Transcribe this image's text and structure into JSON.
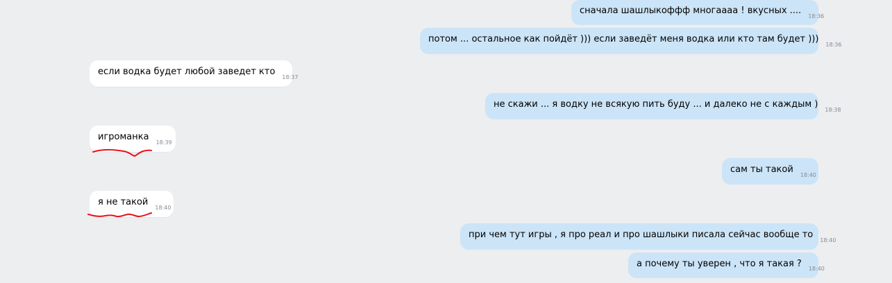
{
  "messages": [
    {
      "text": "сначала шашлыкоффф многаааа ! вкусных ....",
      "time": "18:36",
      "direction": "outgoing"
    },
    {
      "text": "потом ... остальное как пойдёт ))) если заведёт меня водка или кто там будет )))",
      "time": "18:36",
      "direction": "outgoing"
    },
    {
      "text": "если водка будет любой заведет кто",
      "time": "18:37",
      "direction": "incoming"
    },
    {
      "text": "не скажи ... я водку не всякую пить буду ... и далеко не с каждым )",
      "time": "18:38",
      "direction": "outgoing"
    },
    {
      "text": "игроманка",
      "time": "18:39",
      "direction": "incoming",
      "underlined": true
    },
    {
      "text": "сам ты такой",
      "time": "18:40",
      "direction": "outgoing"
    },
    {
      "text": "я не такой",
      "time": "18:40",
      "direction": "incoming",
      "underlined": true
    },
    {
      "text": "при чем тут игры , я про реал и про шашлыки писала сейчас вообще то",
      "time": "18:40",
      "direction": "outgoing"
    },
    {
      "text": "а почему ты уверен , что я такая ?",
      "time": "18:40",
      "direction": "outgoing"
    }
  ],
  "colors": {
    "background": "#edeef0",
    "outgoing_bubble": "#cce4f7",
    "incoming_bubble": "#ffffff",
    "time_text": "#828b96",
    "annotation": "#e8101a"
  }
}
